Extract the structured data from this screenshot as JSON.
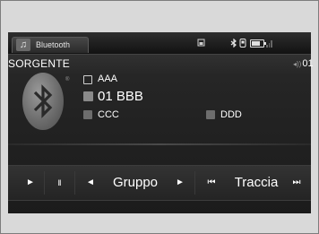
{
  "header": {
    "source_tab_label": "Bluetooth",
    "icons": [
      "music-note-icon",
      "phone-icon",
      "bluetooth-icon",
      "battery-icon",
      "signal-icon"
    ]
  },
  "now_playing": {
    "source_label": "SORGENTE",
    "track_number": "01",
    "album": "AAA",
    "track_title": "01 BBB",
    "artist": "CCC",
    "genre": "DDD"
  },
  "controls": {
    "play_symbol": "►",
    "pause_symbol": "II",
    "group_prev_symbol": "◄",
    "group_label": "Gruppo",
    "group_next_symbol": "►",
    "track_prev_symbol": "⏮",
    "track_label": "Traccia",
    "track_next_symbol": "⏭"
  },
  "colors": {
    "background": "#d9d9d9",
    "screen": "#1b1b1b",
    "text": "#ffffff"
  }
}
